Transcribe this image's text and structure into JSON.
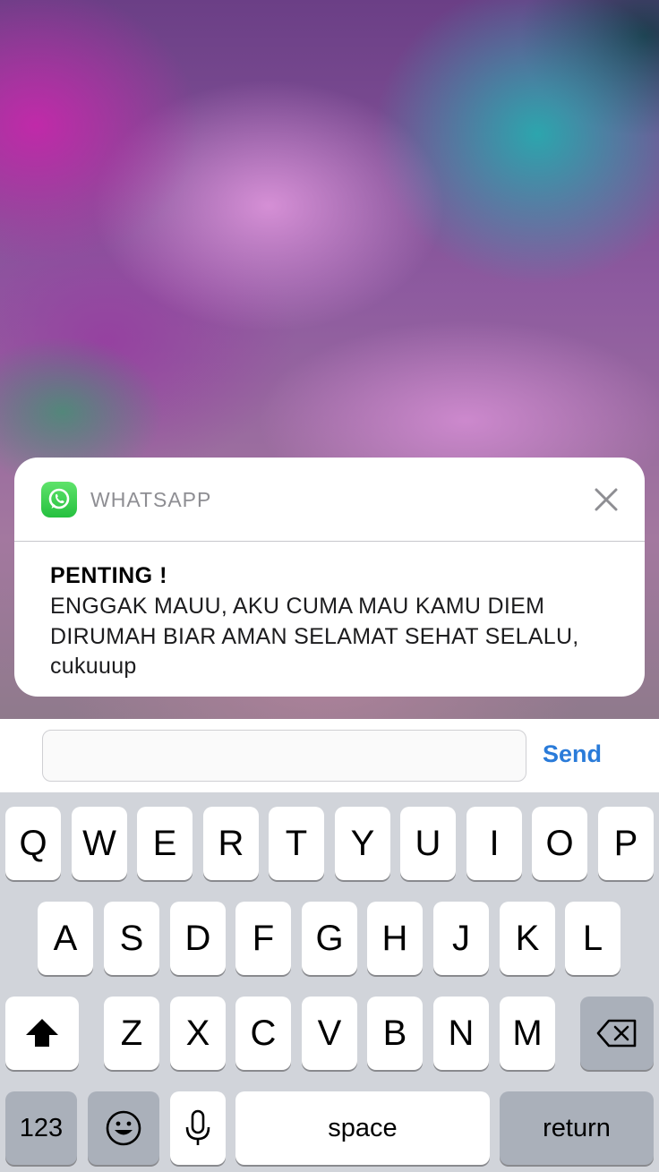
{
  "notification": {
    "app_name": "WHATSAPP",
    "app_icon": "whatsapp-icon",
    "title": "PENTING !",
    "message": "ENGGAK MAUU, AKU CUMA MAU KAMU DIEM DIRUMAH BIAR AMAN SELAMAT SEHAT SELALU, cukuuup"
  },
  "reply": {
    "value": "",
    "send_label": "Send"
  },
  "keyboard": {
    "row1": [
      "Q",
      "W",
      "E",
      "R",
      "T",
      "Y",
      "U",
      "I",
      "O",
      "P"
    ],
    "row2": [
      "A",
      "S",
      "D",
      "F",
      "G",
      "H",
      "J",
      "K",
      "L"
    ],
    "row3": [
      "Z",
      "X",
      "C",
      "V",
      "B",
      "N",
      "M"
    ],
    "numbers_label": "123",
    "space_label": "space",
    "return_label": "return",
    "icons": {
      "shift": "shift-arrow-icon",
      "delete": "backspace-icon",
      "emoji": "emoji-icon",
      "dictation": "microphone-icon"
    }
  },
  "colors": {
    "accent": "#2a7bd9",
    "whatsapp_green": "#25c03f",
    "keyboard_bg": "#d1d4da",
    "dark_key": "#aab0ba"
  }
}
